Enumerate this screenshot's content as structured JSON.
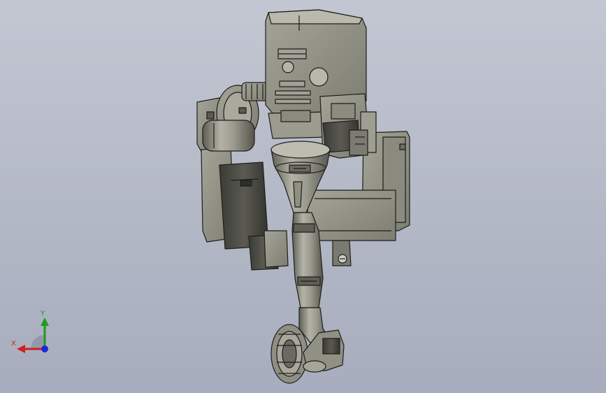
{
  "viewport": {
    "background_top": "#c3c7d2",
    "background_bottom": "#a7adbe"
  },
  "model": {
    "body_color": "#8f8f84",
    "shadow_color": "#4a4a44",
    "highlight_color": "#d4d4c8"
  },
  "triad": {
    "x_label": "X",
    "y_label": "Y",
    "x_color": "#d02020",
    "y_color": "#1e9a1e",
    "z_color": "#1a2ad8"
  }
}
